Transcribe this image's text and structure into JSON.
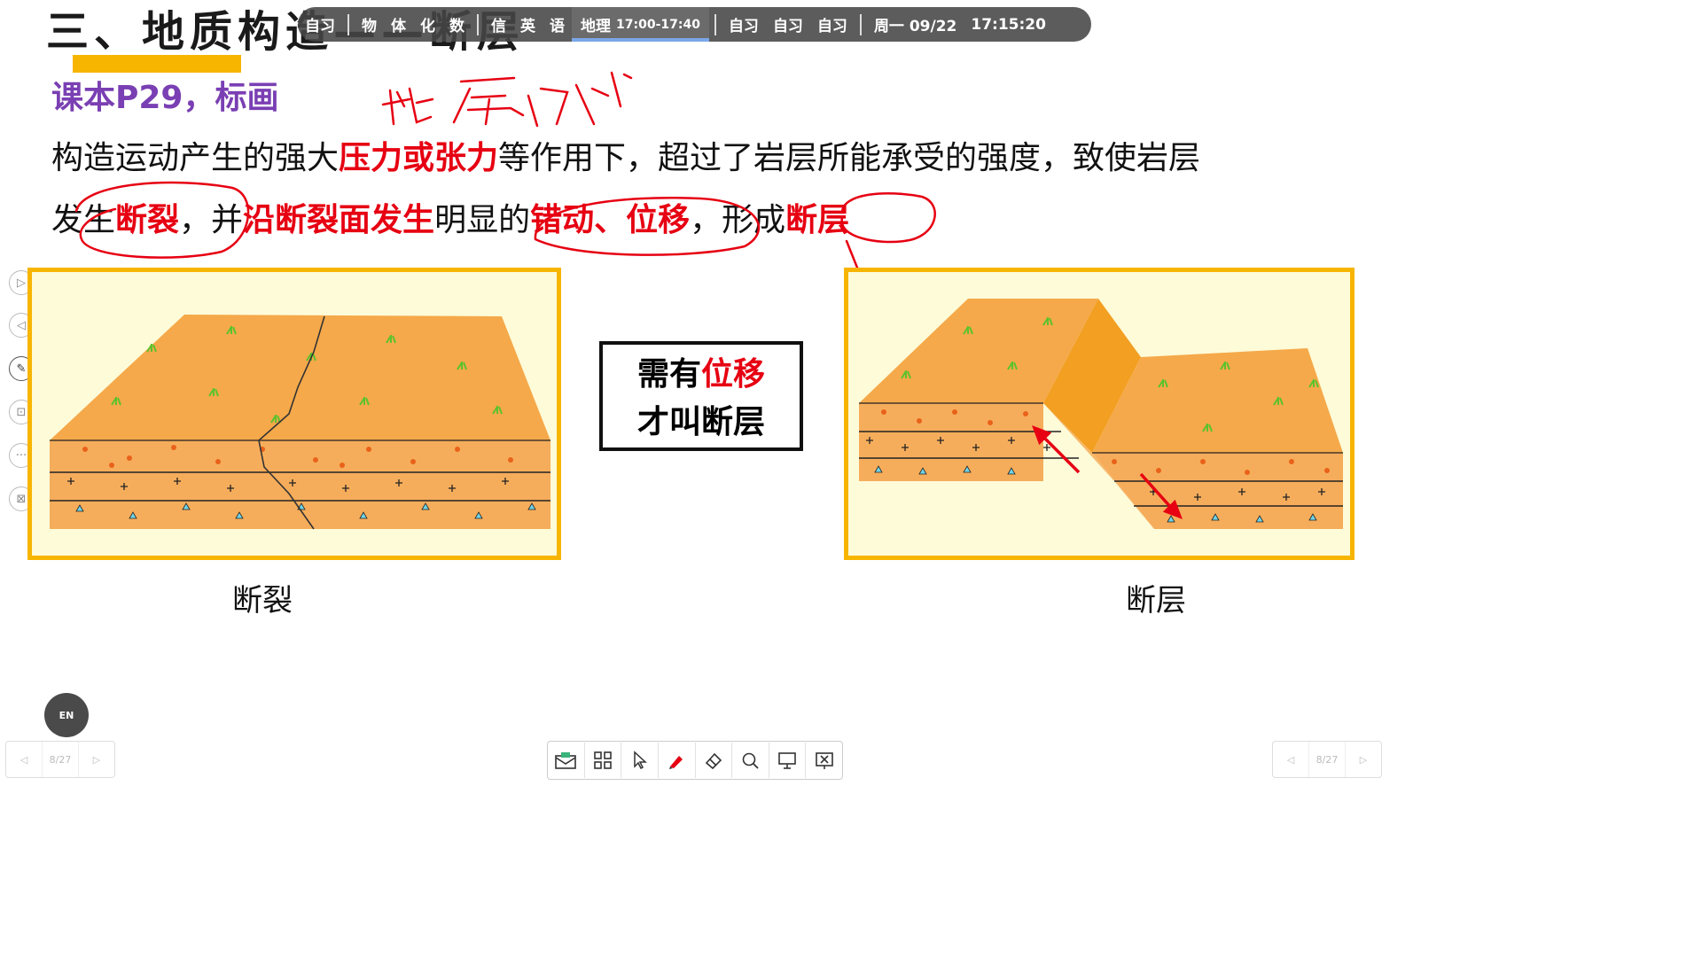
{
  "title": "三、地质构造——断层",
  "subtitle": "课本P29，标画",
  "paragraph": {
    "line1_a": "构造运动产生的强大",
    "line1_red": "压力或张力",
    "line1_b": "等作用下，超过了岩层所能承受的强度，致使岩层",
    "line2_a": "发生",
    "line2_red1": "断裂",
    "line2_b": "，并",
    "line2_red2": "沿断裂面发生",
    "line2_c": "明显的",
    "line2_red3": "错动、位移",
    "line2_d": "，形成",
    "line2_red4": "断层"
  },
  "handwriting": "断层线",
  "schedule": {
    "items": [
      "自习",
      "物",
      "体",
      "化",
      "数",
      "信",
      "英",
      "语"
    ],
    "current_label": "地理",
    "current_time": "17:00-17:40",
    "current_progress": 0.38,
    "after_items": [
      "自习",
      "自习",
      "自习"
    ],
    "date": "周一 09/22",
    "clock": "17:15:20"
  },
  "left_panel_caption": "断裂",
  "right_panel_caption": "断层",
  "note": {
    "line1_a": "需有",
    "line1_red": "位移",
    "line2": "才叫断层"
  },
  "en_button": "EN",
  "pager_left": {
    "page": "8/27"
  },
  "pager_right": {
    "page": "8/27"
  },
  "colors": {
    "accent": "#f7b500",
    "highlight": "#e60012",
    "subtitle": "#7a3fb3",
    "ink": "#e60012"
  }
}
